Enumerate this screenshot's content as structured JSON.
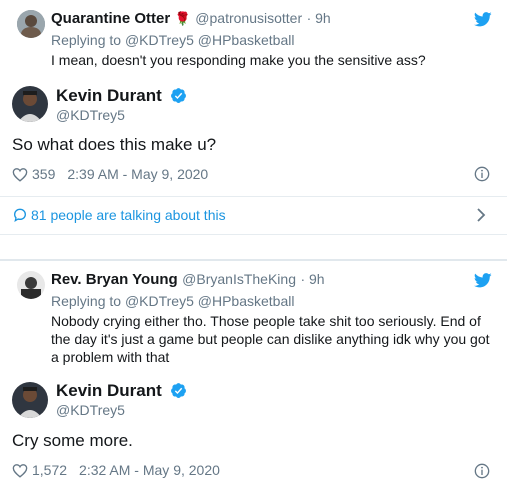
{
  "colors": {
    "twitter_blue": "#1da1f2",
    "link_blue": "#1b95e0",
    "muted": "#657786",
    "text": "#14171a"
  },
  "tweet1": {
    "name": "Quarantine Otter",
    "emoji": "🌹",
    "handle": "@patronusisotter",
    "time": "· 9h",
    "replying_prefix": "Replying to ",
    "replying_to": "@KDTrey5 @HPbasketball",
    "text": "I mean, doesn't you responding make you the sensitive ass?",
    "icon": "twitter-bird-icon"
  },
  "reply1": {
    "name": "Kevin Durant",
    "handle": "@KDTrey5",
    "text": "So what does this make u?",
    "likes": "359",
    "timestamp": "2:39 AM - May 9, 2020",
    "talking": "81 people are talking about this"
  },
  "tweet2": {
    "name": "Rev. Bryan Young",
    "handle": "@BryanIsTheKing",
    "time": "· 9h",
    "replying_prefix": "Replying to ",
    "replying_to": "@KDTrey5 @HPbasketball",
    "text_lines": [
      "Nobody crying either tho. Those people take shit too seriously. End of",
      "the day it's just a game but people can dislike anything idk why you got",
      "a problem with that"
    ]
  },
  "reply2": {
    "name": "Kevin Durant",
    "handle": "@KDTrey5",
    "text": "Cry some more.",
    "likes": "1,572",
    "timestamp": "2:32 AM - May 9, 2020"
  }
}
